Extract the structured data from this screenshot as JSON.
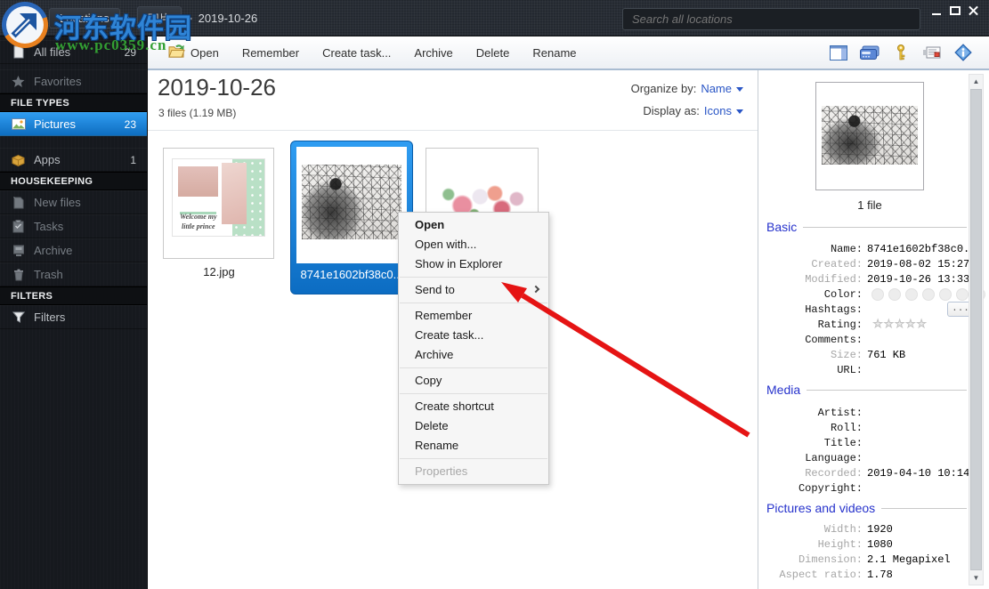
{
  "watermark": {
    "title": "河东软件园",
    "url": "www.pc0359.cn"
  },
  "titlebar": {
    "breadcrumb": [
      "Locations",
      "图片",
      "2019-10-26"
    ],
    "search_placeholder": "Search all locations"
  },
  "toolbar": {
    "buttons": [
      "Open",
      "Remember",
      "Create task...",
      "Archive",
      "Delete",
      "Rename"
    ],
    "right_icons": [
      "layout-panel-icon",
      "card-icon",
      "key-icon",
      "message-icon",
      "info-diamond-icon"
    ]
  },
  "sidebar": {
    "all_files": {
      "label": "All files",
      "count": "29"
    },
    "favorites": {
      "label": "Favorites"
    },
    "file_types_header": "FILE TYPES",
    "pictures": {
      "label": "Pictures",
      "count": "23"
    },
    "apps": {
      "label": "Apps",
      "count": "1"
    },
    "housekeeping_header": "HOUSEKEEPING",
    "new_files": {
      "label": "New files"
    },
    "tasks": {
      "label": "Tasks"
    },
    "archive": {
      "label": "Archive"
    },
    "trash": {
      "label": "Trash"
    },
    "filters_header": "FILTERS",
    "filters": {
      "label": "Filters"
    }
  },
  "content": {
    "title": "2019-10-26",
    "subtitle": "3 files (1.19 MB)",
    "organize_by_label": "Organize by:",
    "organize_by_value": "Name",
    "display_as_label": "Display as:",
    "display_as_value": "Icons",
    "files": [
      {
        "name": "12.jpg",
        "thumb_caption": "Welcome my little prince"
      },
      {
        "name": "8741e1602bf38c0..."
      },
      {
        "name": ""
      }
    ]
  },
  "context_menu": {
    "items": [
      "Open",
      "Open with...",
      "Show in Explorer",
      "Send to",
      "Remember",
      "Create task...",
      "Archive",
      "Copy",
      "Create shortcut",
      "Delete",
      "Rename",
      "Properties"
    ]
  },
  "details": {
    "count_label": "1 file",
    "basic": {
      "title": "Basic",
      "name_label": "Name:",
      "name": "8741e1602bf38c0...",
      "created_label": "Created:",
      "created": "2019-08-02 15:27",
      "modified_label": "Modified:",
      "modified": "2019-10-26 13:33",
      "color_label": "Color:",
      "hashtags_label": "Hashtags:",
      "hashtags_button": "...",
      "rating_label": "Rating:",
      "comments_label": "Comments:",
      "size_label": "Size:",
      "size": "761 KB",
      "url_label": "URL:"
    },
    "media": {
      "title": "Media",
      "artist_label": "Artist:",
      "roll_label": "Roll:",
      "title_label": "Title:",
      "language_label": "Language:",
      "recorded_label": "Recorded:",
      "recorded": "2019-04-10 10:14",
      "copyright_label": "Copyright:"
    },
    "pictures": {
      "title": "Pictures and videos",
      "width_label": "Width:",
      "width": "1920",
      "height_label": "Height:",
      "height": "1080",
      "dimension_label": "Dimension:",
      "dimension": "2.1 Megapixel",
      "aspect_label": "Aspect ratio:",
      "aspect": "1.78"
    }
  },
  "colors": {
    "selection_blue": "#1e8ce0",
    "section_title_blue": "#2733cc",
    "arrow_red": "#e51414",
    "watermark_blue": "#2f84d6",
    "watermark_green": "#33a033"
  }
}
